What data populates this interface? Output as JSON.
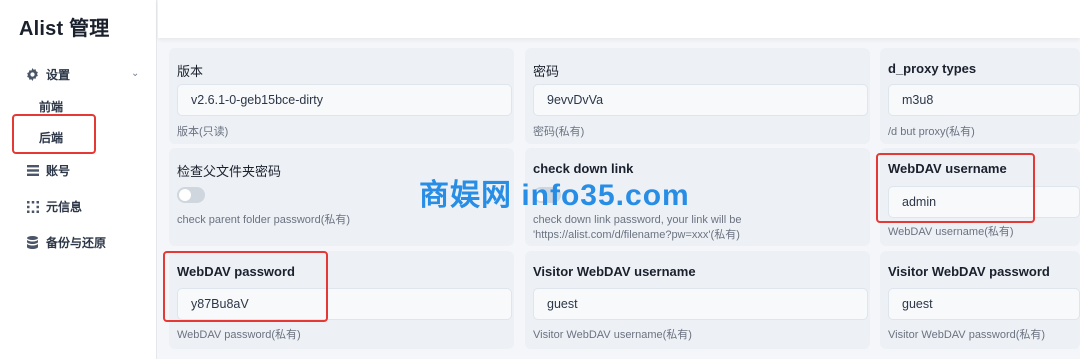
{
  "app": {
    "title": "Alist 管理"
  },
  "sidebar": {
    "settings": {
      "label": "设置",
      "icon": "gear-icon"
    },
    "sub_items": [
      {
        "label": "前端"
      },
      {
        "label": "后端"
      }
    ],
    "items": [
      {
        "label": "账号",
        "icon": "list-icon"
      },
      {
        "label": "元信息",
        "icon": "grid-icon"
      },
      {
        "label": "备份与还原",
        "icon": "database-icon"
      }
    ]
  },
  "fields": [
    {
      "title": "版本",
      "value": "v2.6.1-0-geb15bce-dirty",
      "help": "版本(只读)"
    },
    {
      "title": "密码",
      "value": "9evvDvVa",
      "help": "密码(私有)"
    },
    {
      "title": "d_proxy types",
      "value": "m3u8",
      "help": "/d but proxy(私有)"
    },
    {
      "title": "检查父文件夹密码",
      "toggle": false,
      "help": "check parent folder password(私有)"
    },
    {
      "title": "check down link",
      "toggle": false,
      "help_line1": "check down link password, your link will be",
      "help_line2": "'https://alist.com/d/filename?pw=xxx'(私有)"
    },
    {
      "title": "WebDAV username",
      "value": "admin",
      "help": "WebDAV username(私有)"
    },
    {
      "title": "WebDAV password",
      "value": "y87Bu8aV",
      "help": "WebDAV password(私有)"
    },
    {
      "title": "Visitor WebDAV username",
      "value": "guest",
      "help": "Visitor WebDAV username(私有)"
    },
    {
      "title": "Visitor WebDAV password",
      "value": "guest",
      "help": "Visitor WebDAV password(私有)"
    }
  ],
  "watermark": "商娱网 info35.com",
  "colors": {
    "highlight": "#e53935",
    "watermark": "#1e88e5"
  }
}
